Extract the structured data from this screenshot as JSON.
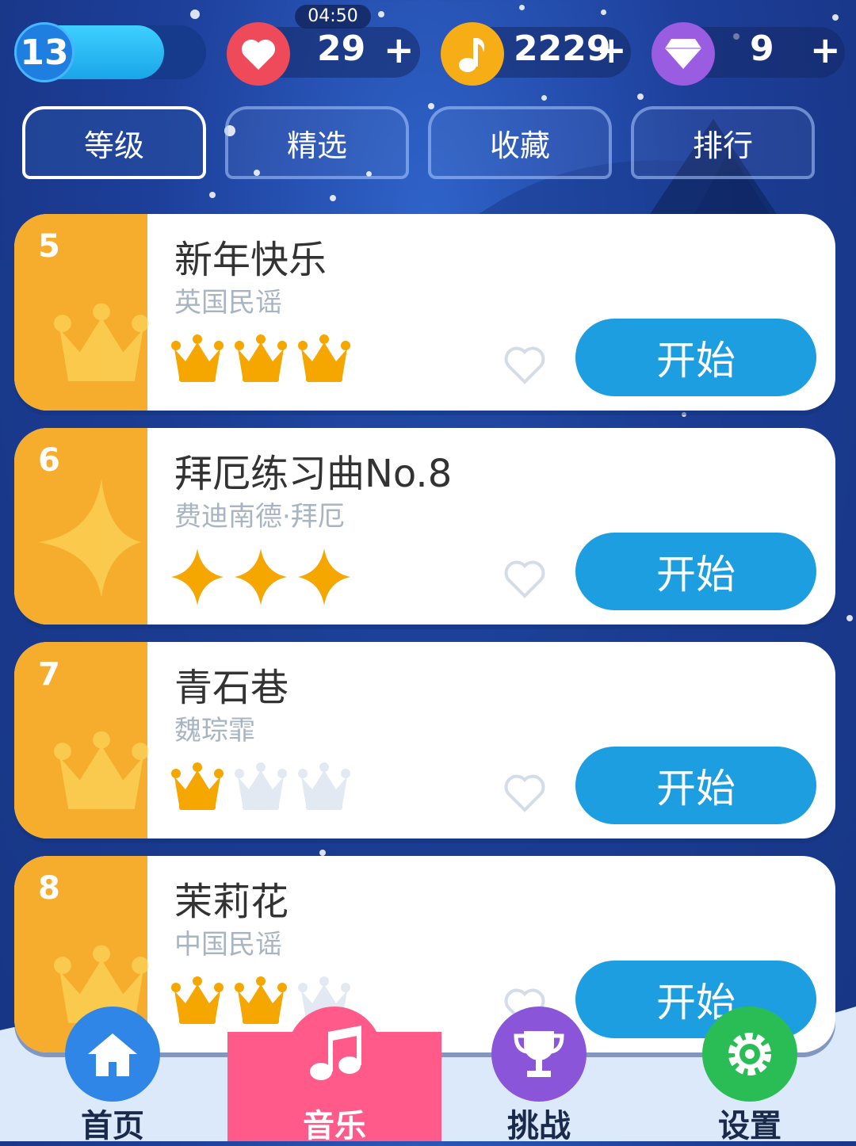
{
  "status": {
    "level": "13",
    "level_progress": 0.78,
    "timer": "04:50",
    "hearts": "29",
    "notes": "2229",
    "gems": "9",
    "plus": "+"
  },
  "tabs": [
    {
      "label": "等级",
      "active": true
    },
    {
      "label": "精选",
      "active": false
    },
    {
      "label": "收藏",
      "active": false
    },
    {
      "label": "排行",
      "active": false
    }
  ],
  "songs": [
    {
      "rank": "5",
      "title": "新年快乐",
      "artist": "英国民谣",
      "mark_type": "crown",
      "rating": 3,
      "start_label": "开始"
    },
    {
      "rank": "6",
      "title": "拜厄练习曲No.8",
      "artist": "费迪南德·拜厄",
      "mark_type": "star",
      "rating": 3,
      "start_label": "开始"
    },
    {
      "rank": "7",
      "title": "青石巷",
      "artist": "魏琮霏",
      "mark_type": "crown",
      "rating": 1,
      "start_label": "开始"
    },
    {
      "rank": "8",
      "title": "茉莉花",
      "artist": "中国民谣",
      "mark_type": "crown",
      "rating": 2,
      "start_label": "开始"
    }
  ],
  "nav": [
    {
      "label": "首页",
      "icon": "home-icon",
      "color": "#2f86e6"
    },
    {
      "label": "音乐",
      "icon": "music-note-icon",
      "color": "#ff5a8a",
      "active": true
    },
    {
      "label": "挑战",
      "icon": "trophy-icon",
      "color": "#8a55d8"
    },
    {
      "label": "设置",
      "icon": "gear-icon",
      "color": "#2bbd55"
    }
  ],
  "colors": {
    "accent": "#1c9ee0",
    "card_side": "#f6ac2c",
    "mark_gold": "#f5a700",
    "mark_empty": "#e3e9f2",
    "heart": "#ef4a5a",
    "note": "#f7ae16",
    "gem": "#9a5ce0"
  }
}
